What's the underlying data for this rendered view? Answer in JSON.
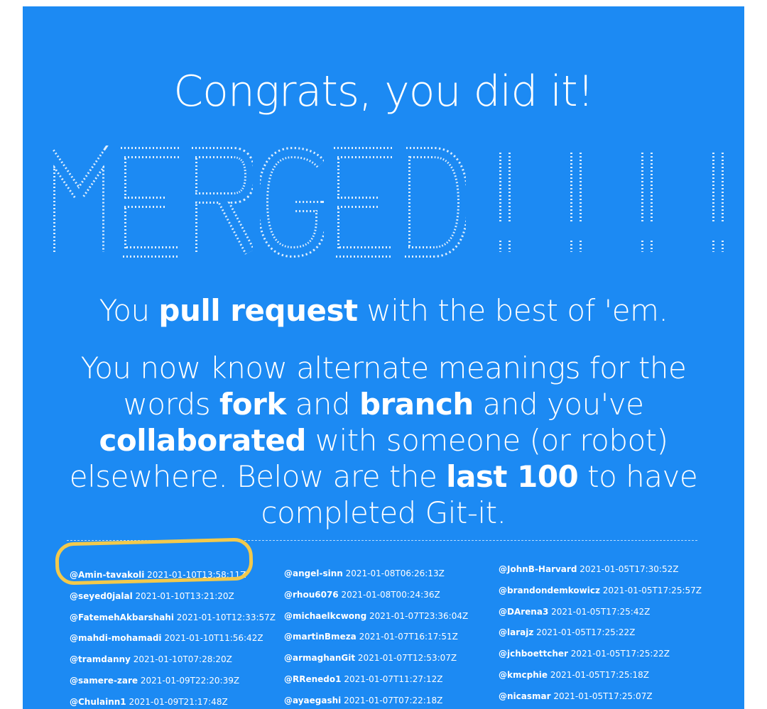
{
  "page": {
    "title": "Congrats, you did it!",
    "tagline": {
      "pre": "You ",
      "bold": "pull request",
      "post": " with the best of 'em."
    },
    "body": {
      "t1": "You now know alternate meanings for the words ",
      "b1": "fork",
      "t2": " and ",
      "b2": "branch",
      "t3": " and you've ",
      "b3": "collaborated",
      "t4": " with someone (or robot) elsewhere. Below are the ",
      "b4": "last 100",
      "t5": " to have completed Git-it."
    }
  },
  "banner": {
    "letters": [
      "M",
      "E",
      "R",
      "G",
      "E",
      "D",
      "!",
      "!",
      "!",
      "!"
    ]
  },
  "colors": {
    "panel": "#1c8af3",
    "text": "#ffffff",
    "highlight": "#f2c94c"
  },
  "completions": {
    "col1": [
      {
        "user": "@Amin-tavakoli",
        "time": "2021-01-10T13:58:11Z"
      },
      {
        "user": "@seyed0jalal",
        "time": "2021-01-10T13:21:20Z"
      },
      {
        "user": "@FatemehAkbarshahi",
        "time": "2021-01-10T12:33:57Z"
      },
      {
        "user": "@mahdi-mohamadi",
        "time": "2021-01-10T11:56:42Z"
      },
      {
        "user": "@tramdanny",
        "time": "2021-01-10T07:28:20Z"
      },
      {
        "user": "@samere-zare",
        "time": "2021-01-09T22:20:39Z"
      },
      {
        "user": "@Chulainn1",
        "time": "2021-01-09T21:17:48Z"
      }
    ],
    "col2": [
      {
        "user": "@angel-sinn",
        "time": "2021-01-08T06:26:13Z"
      },
      {
        "user": "@rhou6076",
        "time": "2021-01-08T00:24:36Z"
      },
      {
        "user": "@michaelkcwong",
        "time": "2021-01-07T23:36:04Z"
      },
      {
        "user": "@martinBmeza",
        "time": "2021-01-07T16:17:51Z"
      },
      {
        "user": "@armaghanGit",
        "time": "2021-01-07T12:53:07Z"
      },
      {
        "user": "@RRenedo1",
        "time": "2021-01-07T11:27:12Z"
      },
      {
        "user": "@ayaegashi",
        "time": "2021-01-07T07:22:18Z"
      }
    ],
    "col3": [
      {
        "user": "@JohnB-Harvard",
        "time": "2021-01-05T17:30:52Z"
      },
      {
        "user": "@brandondemkowicz",
        "time": "2021-01-05T17:25:57Z"
      },
      {
        "user": "@DArena3",
        "time": "2021-01-05T17:25:42Z"
      },
      {
        "user": "@larajz",
        "time": "2021-01-05T17:25:22Z"
      },
      {
        "user": "@jchboettcher",
        "time": "2021-01-05T17:25:22Z"
      },
      {
        "user": "@kmcphie",
        "time": "2021-01-05T17:25:18Z"
      },
      {
        "user": "@nicasmar",
        "time": "2021-01-05T17:25:07Z"
      }
    ]
  }
}
